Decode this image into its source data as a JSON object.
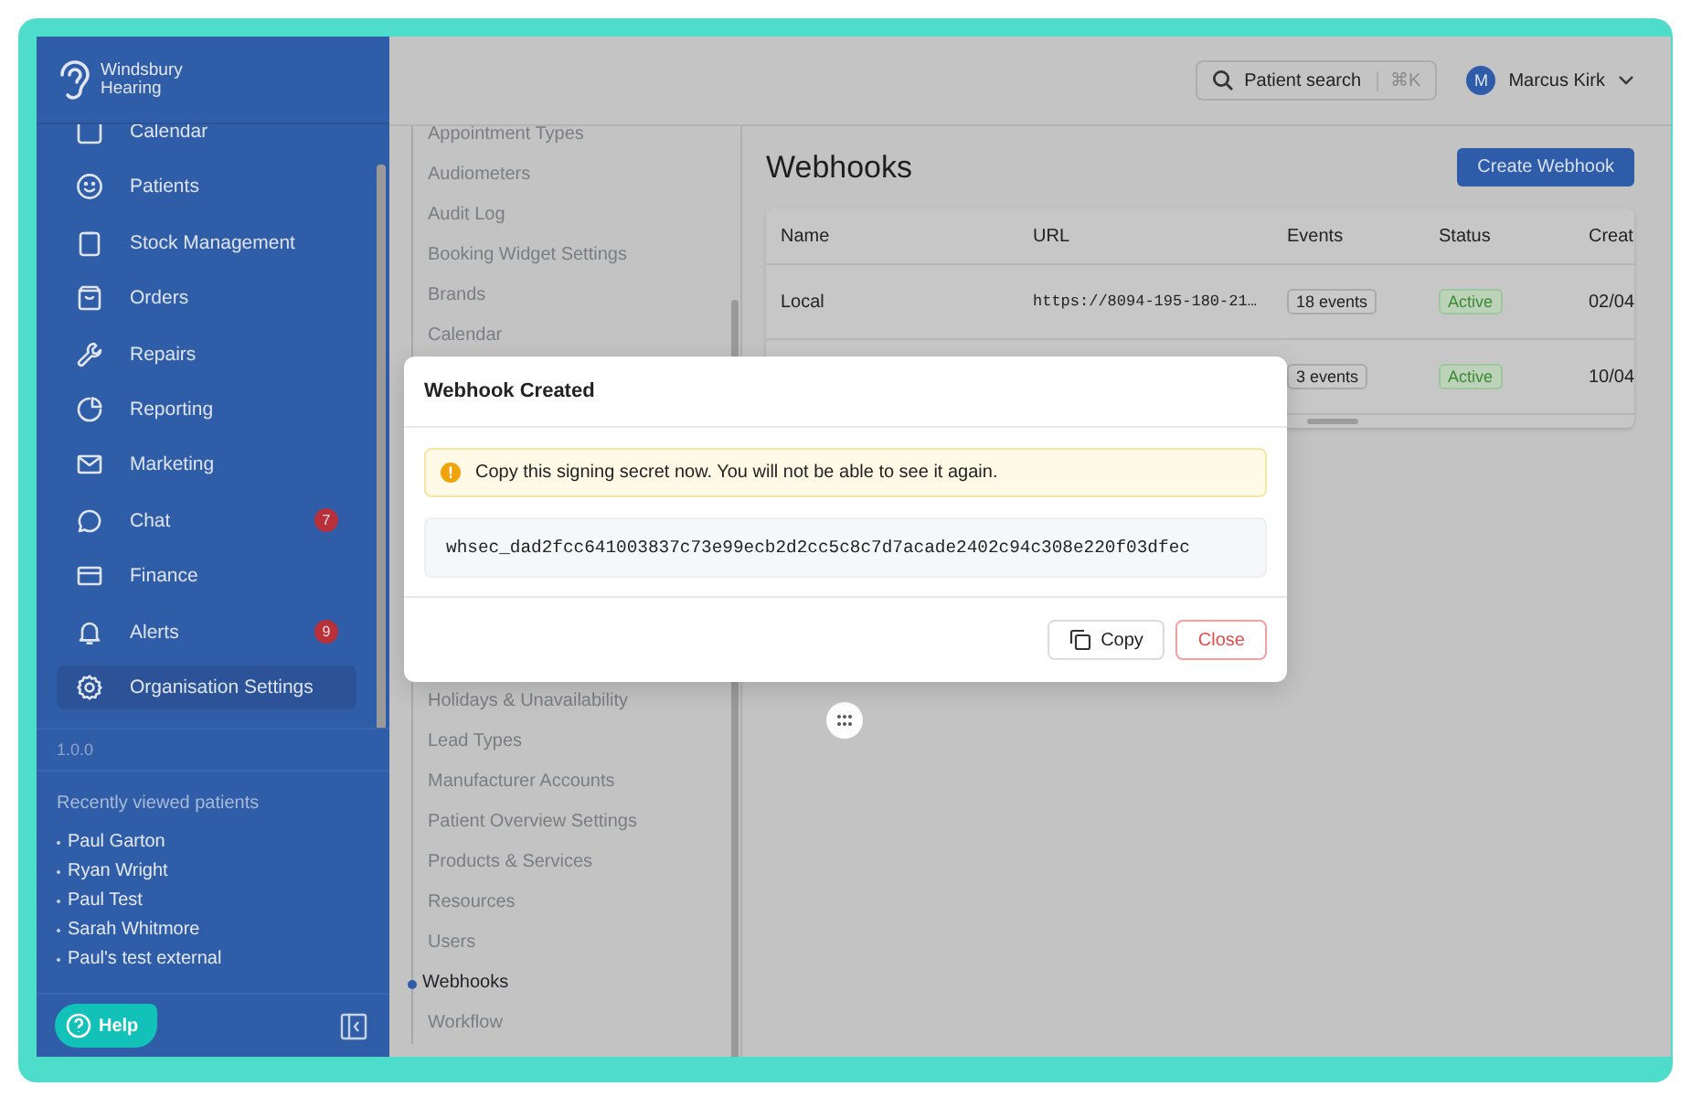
{
  "brand": {
    "lines": [
      "Windsbury",
      "Hearing"
    ]
  },
  "sidebar": {
    "nav_items": [
      {
        "label": "Calendar",
        "selected": false
      },
      {
        "label": "Patients",
        "selected": false
      },
      {
        "label": "Stock Management",
        "selected": false
      },
      {
        "label": "Orders",
        "selected": false
      },
      {
        "label": "Repairs",
        "selected": false
      },
      {
        "label": "Reporting",
        "selected": false
      },
      {
        "label": "Marketing",
        "selected": false
      },
      {
        "label": "Chat",
        "badge": "7",
        "selected": false
      },
      {
        "label": "Finance",
        "selected": false
      },
      {
        "label": "Alerts",
        "badge": "9",
        "selected": false
      },
      {
        "label": "Organisation Settings",
        "selected": true
      }
    ],
    "version": "1.0.0",
    "recent_title": "Recently viewed patients",
    "recent_patients": [
      "Paul Garton",
      "Ryan Wright",
      "Paul Test",
      "Sarah Whitmore",
      "Paul's test external"
    ],
    "help_button": "Help"
  },
  "header": {
    "search": {
      "label": "Patient search",
      "shortcut": "⌘K"
    },
    "user": {
      "initial": "M",
      "name": "Marcus Kirk"
    }
  },
  "settings_menu": {
    "items_top": [
      {
        "label": "Appointment Types",
        "selected": false
      },
      {
        "label": "Audiometers",
        "selected": false
      },
      {
        "label": "Audit Log",
        "selected": false
      },
      {
        "label": "Booking Widget Settings",
        "selected": false
      },
      {
        "label": "Brands",
        "selected": false
      },
      {
        "label": "Calendar",
        "selected": false
      }
    ],
    "items_bottom": [
      {
        "label": "Holidays & Unavailability",
        "selected": false
      },
      {
        "label": "Lead Types",
        "selected": false
      },
      {
        "label": "Manufacturer Accounts",
        "selected": false
      },
      {
        "label": "Patient Overview Settings",
        "selected": false
      },
      {
        "label": "Products & Services",
        "selected": false
      },
      {
        "label": "Resources",
        "selected": false
      },
      {
        "label": "Users",
        "selected": false
      },
      {
        "label": "Webhooks",
        "selected": true
      },
      {
        "label": "Workflow",
        "selected": false
      }
    ]
  },
  "page": {
    "title": "Webhooks",
    "create_button": "Create Webhook",
    "table": {
      "columns": [
        "Name",
        "URL",
        "Events",
        "Status",
        "Creat"
      ],
      "rows": [
        {
          "name": "Local",
          "url": "https://8094-195-180-21…",
          "events": "18 events",
          "status": "Active",
          "created": "02/04"
        },
        {
          "events": "3 events",
          "status": "Active",
          "created": "10/04"
        }
      ]
    }
  },
  "dialog": {
    "title": "Webhook Created",
    "warning": "Copy this signing secret now. You will not be able to see it again.",
    "secret": "whsec_dad2fcc641003837c73e99ecb2d2cc5c8c7d7acade2402c94c308e220f03dfec",
    "buttons": [
      {
        "label": "Copy",
        "kind": "secondary"
      },
      {
        "label": "Close",
        "kind": "danger"
      }
    ]
  }
}
